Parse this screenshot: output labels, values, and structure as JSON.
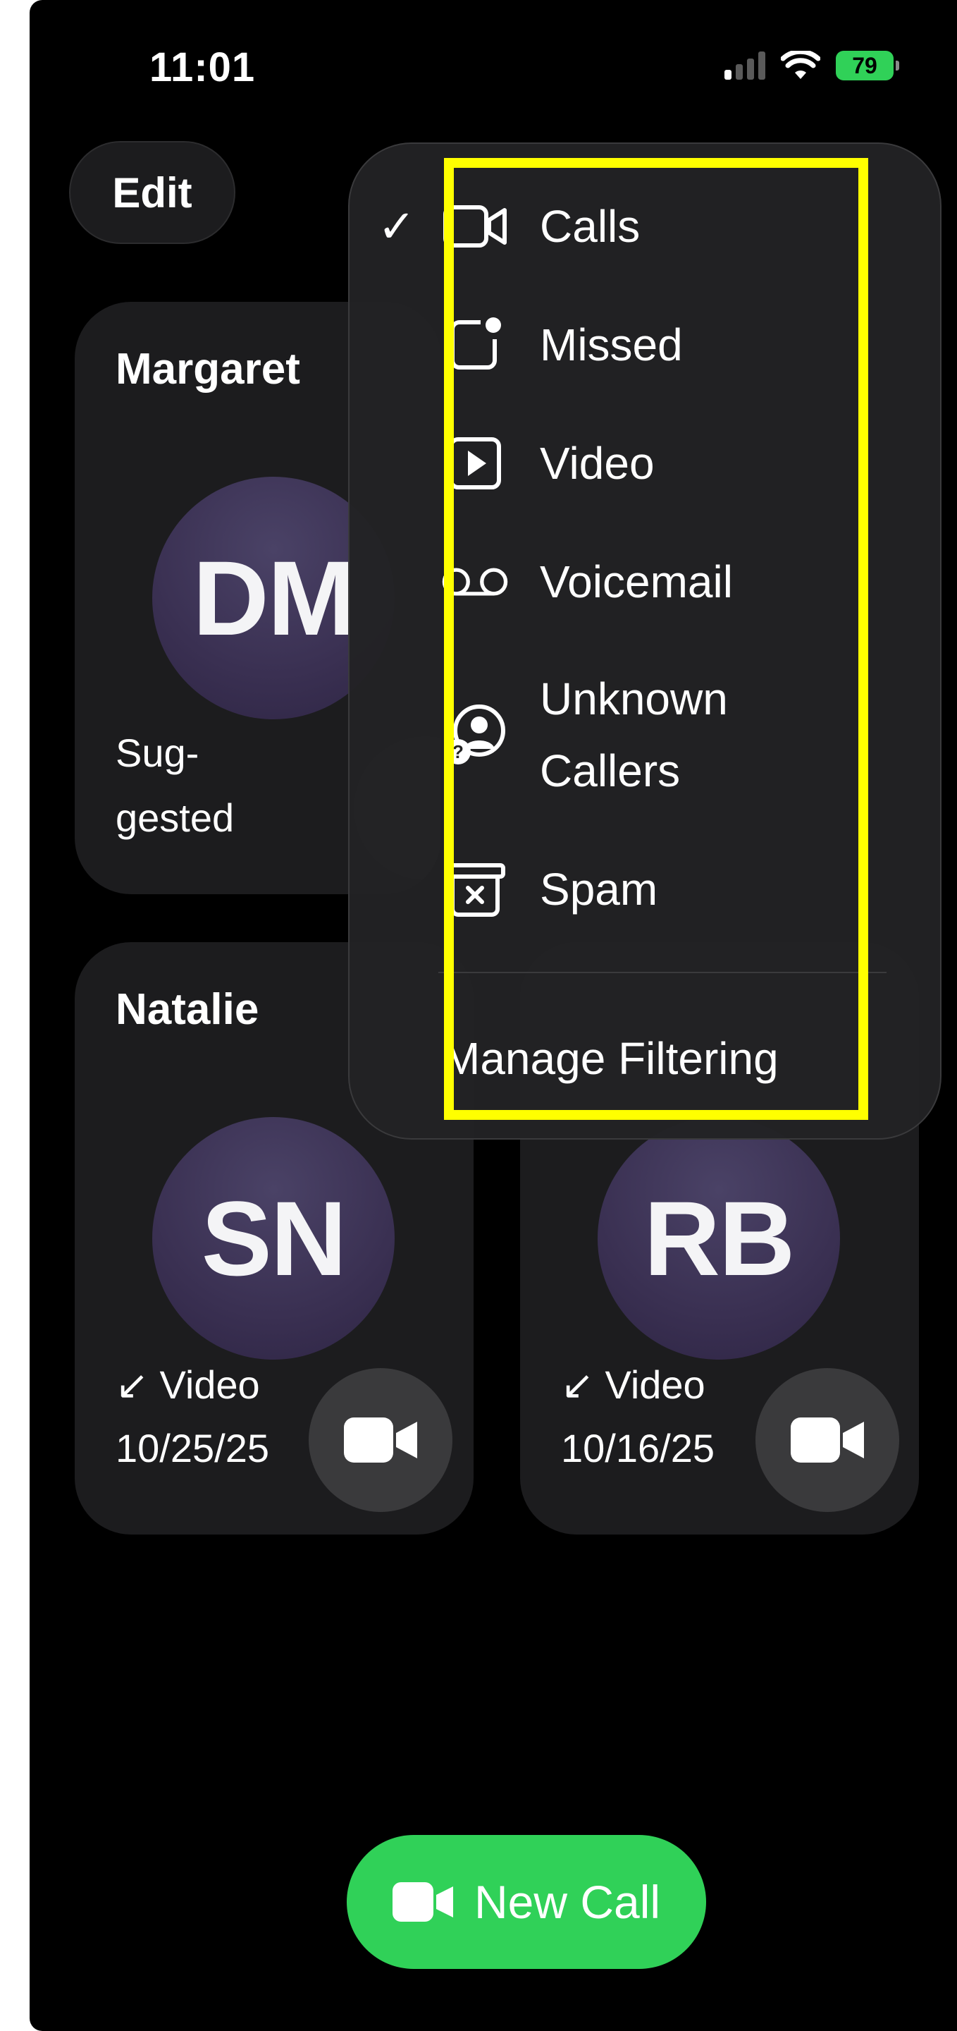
{
  "status_bar": {
    "time": "11:01",
    "battery_percent": "79"
  },
  "header": {
    "edit_label": "Edit"
  },
  "cards": [
    {
      "name": "Margaret",
      "initials": "DM",
      "line1": "Sug-",
      "line2": "gested"
    },
    {
      "name": "Natalie",
      "initials": "SN",
      "line1": "↙ Video",
      "line2": "10/25/25"
    },
    {
      "initials": "RB",
      "line1": "↙ Video",
      "line2": "10/16/25"
    }
  ],
  "filter_menu": {
    "items": [
      {
        "label": "Calls",
        "icon": "video-camera-icon",
        "selected": true
      },
      {
        "label": "Missed",
        "icon": "missed-badge-icon",
        "selected": false
      },
      {
        "label": "Video",
        "icon": "video-play-icon",
        "selected": false
      },
      {
        "label": "Voicemail",
        "icon": "voicemail-icon",
        "selected": false
      },
      {
        "label": "Unknown",
        "label2": "Callers",
        "icon": "unknown-callers-icon",
        "selected": false
      },
      {
        "label": "Spam",
        "icon": "spam-bin-icon",
        "selected": false
      }
    ],
    "manage_label": "Manage Filtering",
    "check_glyph": "✓"
  },
  "new_call": {
    "label": "New Call",
    "color": "#30d158"
  },
  "colors": {
    "highlight": "#ffff00",
    "background": "#000000"
  }
}
